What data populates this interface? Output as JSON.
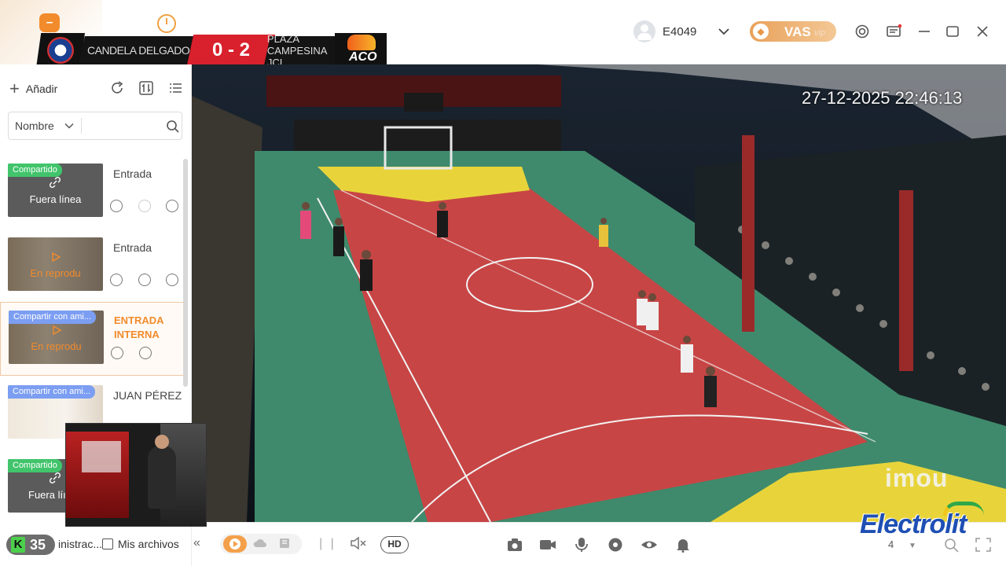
{
  "header": {
    "app_badge_glyph": "–",
    "username": "E4049",
    "vas_label": "VAS",
    "vas_suffix": "vip"
  },
  "scoreboard": {
    "team_left": "CANDELA DELGADO",
    "score": "0 - 2",
    "team_right": "PLAZA CAMPESINA JCI",
    "right_logo_text": "ACO"
  },
  "sidebar": {
    "add_label": "Añadir",
    "search_filter": "Nombre",
    "search_placeholder": "",
    "devices": [
      {
        "tag": "Compartido",
        "tag_color": "green",
        "name": "Entrada",
        "status": "Fuera línea",
        "selected": false
      },
      {
        "tag": "",
        "tag_color": "",
        "name": "Entrada",
        "status": "En reprodu",
        "selected": false
      },
      {
        "tag": "Compartir con ami...",
        "tag_color": "blue",
        "name": "ENTRADA INTERNA",
        "status": "En reprodu",
        "selected": true
      },
      {
        "tag": "Compartir con ami...",
        "tag_color": "blue",
        "name": "JUAN PÉREZ",
        "status": "",
        "selected": false
      },
      {
        "tag": "Compartido",
        "tag_color": "green",
        "name": "",
        "status": "Fuera líı",
        "selected": false
      }
    ],
    "bottom": {
      "k_label": "K",
      "k_number": "35",
      "admin_label": "inistrac...",
      "files_label": "Mis archivos",
      "collapse_glyph": "«"
    }
  },
  "video": {
    "timestamp": "27-12-2025 22:46:13",
    "watermark": "imou"
  },
  "controlbar": {
    "quality_label": "HD",
    "split_count": "4"
  },
  "sponsor": {
    "logo_text": "Electrolit"
  },
  "colors": {
    "accent": "#f28b2c",
    "shared_tag": "#41c46b",
    "share_friends_tag": "#7c9ef2",
    "court_red": "#c84545",
    "court_green": "#3f8a6c",
    "court_yellow": "#e8d43a"
  }
}
